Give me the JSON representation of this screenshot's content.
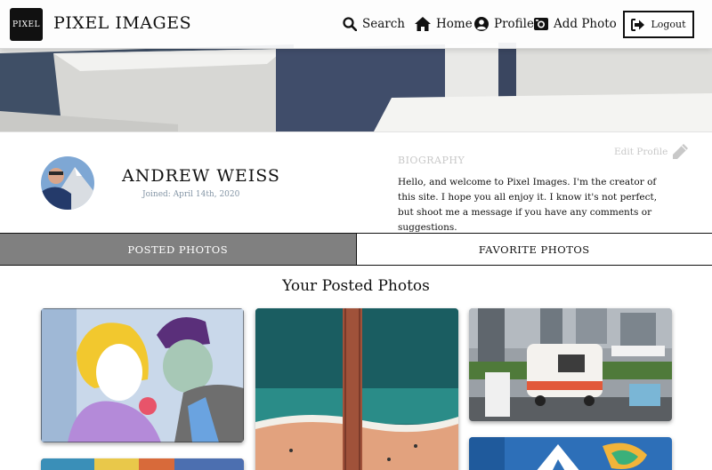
{
  "nav": {
    "logo_text": "PIXEL",
    "brand": "PIXEL IMAGES",
    "search_label": "Search",
    "home_label": "Home",
    "profile_label": "Profile",
    "add_photo_label": "Add Photo",
    "logout_label": "Logout"
  },
  "profile": {
    "name": "ANDREW WEISS",
    "joined": "Joined: April 14th, 2020",
    "edit_label": "Edit Profile",
    "bio_label": "BIOGRAPHY",
    "bio_text": "Hello, and welcome to Pixel Images. I'm the creator of this site. I hope you all enjoy it. I know it's not perfect, but shoot me a message if you have any comments or suggestions."
  },
  "tabs": {
    "posted": "POSTED PHOTOS",
    "favorite": "FAVORITE PHOTOS"
  },
  "section_title": "Your Posted Photos",
  "colors": {
    "tab_active_bg": "#808080",
    "muted_text": "#c8c8c8",
    "joined_text": "#8596a6"
  }
}
